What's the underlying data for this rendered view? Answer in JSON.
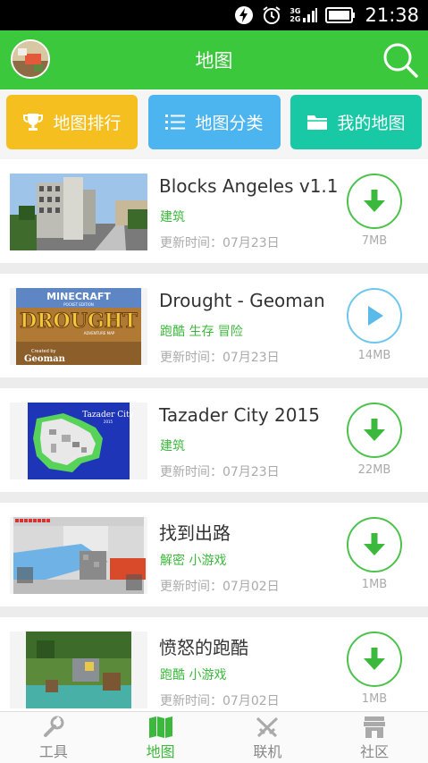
{
  "status_bar": {
    "network_top": "3G",
    "network_bottom": "2G",
    "time": "21:38"
  },
  "header": {
    "title": "地图",
    "avatar_icon": "avatar",
    "search_icon": "search-icon"
  },
  "categories": [
    {
      "label": "地图排行",
      "icon": "trophy-icon",
      "color": "#f5bf1f"
    },
    {
      "label": "地图分类",
      "icon": "list-icon",
      "color": "#4cb4ee"
    },
    {
      "label": "我的地图",
      "icon": "folder-icon",
      "color": "#19c9a6"
    }
  ],
  "maps": [
    {
      "name": "Blocks Angeles v1.1",
      "tags": "建筑",
      "date": "更新时间：07月23日",
      "size": "7MB",
      "action": "download"
    },
    {
      "name": "Drought - Geoman",
      "tags": "跑酷 生存 冒险",
      "date": "更新时间：07月23日",
      "size": "14MB",
      "action": "play"
    },
    {
      "name": "Tazader City 2015",
      "tags": "建筑",
      "date": "更新时间：07月23日",
      "size": "22MB",
      "action": "download"
    },
    {
      "name": "找到出路",
      "tags": "解密 小游戏",
      "date": "更新时间：07月02日",
      "size": "1MB",
      "action": "download"
    },
    {
      "name": "愤怒的跑酷",
      "tags": "跑酷 小游戏",
      "date": "更新时间：07月02日",
      "size": "1MB",
      "action": "download"
    }
  ],
  "thumb_text": {
    "drought_top": "MINECRAFT",
    "drought_sub": "POCKET EDITION",
    "drought_title": "DROUGHT",
    "drought_tag": "ADVENTURE MAP",
    "drought_by": "Created by",
    "drought_author": "Geoman",
    "tazader_title": "Tazader City",
    "tazader_year": "2015"
  },
  "bottom_nav": [
    {
      "label": "工具",
      "icon": "wrench-icon",
      "active": false
    },
    {
      "label": "地图",
      "icon": "map-icon",
      "active": true
    },
    {
      "label": "联机",
      "icon": "swords-icon",
      "active": false
    },
    {
      "label": "社区",
      "icon": "store-icon",
      "active": false
    }
  ],
  "colors": {
    "primary_green": "#3cc83c",
    "tag_green": "#3cb93c",
    "play_blue": "#6fc6ec"
  }
}
